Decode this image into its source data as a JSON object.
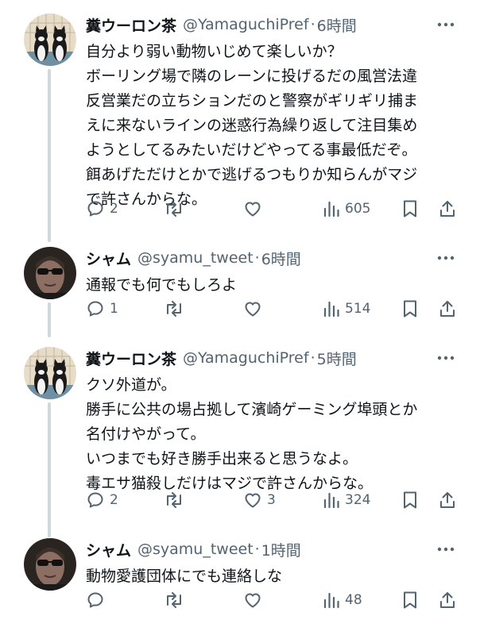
{
  "tweets": [
    {
      "name": "糞ウーロン茶",
      "handle": "@YamaguchiPref",
      "dot": "·",
      "time": "6時間",
      "avatar": "cats-avatar",
      "body": [
        "自分より弱い動物いじめて楽しいか？",
        "ボーリング場で隣のレーンに投げるだの風営法違",
        "反営業だの立ちションだのと警察がギリギリ捕ま",
        "えに来ないラインの迷惑行為繰り返して注目集め",
        "ようとしてるみたいだけどやってる事最低だぞ。",
        "餌あげただけとかで逃げるつもりか知らんがマジ",
        "で許さんからな。"
      ],
      "replies": "2",
      "retweets": "",
      "likes": "",
      "views": "605"
    },
    {
      "name": "シャム",
      "handle": "@syamu_tweet",
      "dot": "·",
      "time": "6時間",
      "avatar": "man-avatar",
      "body": [
        "通報でも何でもしろよ"
      ],
      "replies": "1",
      "retweets": "",
      "likes": "",
      "views": "514"
    },
    {
      "name": "糞ウーロン茶",
      "handle": "@YamaguchiPref",
      "dot": "·",
      "time": "5時間",
      "avatar": "cats-avatar",
      "body": [
        "クソ外道が。",
        "勝手に公共の場占拠して濱崎ゲーミング埠頭とか",
        "名付けやがって。",
        "いつまでも好き勝手出来ると思うなよ。",
        "毒エサ猫殺しだけはマジで許さんからな。"
      ],
      "replies": "2",
      "retweets": "",
      "likes": "3",
      "views": "324"
    },
    {
      "name": "シャム",
      "handle": "@syamu_tweet",
      "dot": "·",
      "time": "1時間",
      "avatar": "man-avatar",
      "body": [
        "動物愛護団体にでも連絡しな"
      ],
      "replies": "",
      "retweets": "",
      "likes": "",
      "views": "48"
    }
  ],
  "icons": {
    "reply": "reply-icon",
    "retweet": "retweet-icon",
    "like": "like-icon",
    "views": "views-icon",
    "bookmark": "bookmark-icon",
    "share": "share-icon",
    "more": "more-icon"
  },
  "colors": {
    "text": "#0f1419",
    "secondary": "#536471",
    "thread_line": "#cfd9de"
  }
}
